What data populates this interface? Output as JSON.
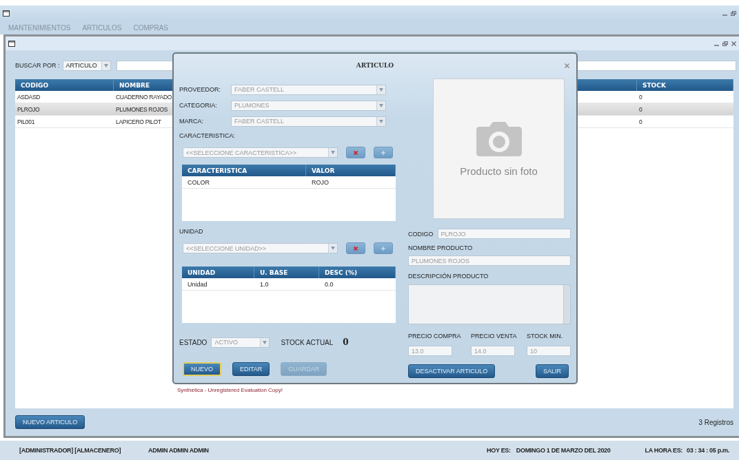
{
  "window": {
    "menu": [
      {
        "label": "MANTENIMIENTOS"
      },
      {
        "label": "ARTICULOS"
      },
      {
        "label": "COMPRAS"
      }
    ]
  },
  "articles": {
    "search": {
      "label": "BUSCAR POR :",
      "by": "ARTICULO"
    },
    "table": {
      "columns": [
        "CODIGO",
        "NOMBRE",
        "STOCK"
      ],
      "rows": [
        {
          "cells": [
            "ASDASD",
            "CUADERNO RAYADO",
            "0"
          ],
          "selected": false
        },
        {
          "cells": [
            "PLROJO",
            "PLUMONES ROJOS",
            "0"
          ],
          "selected": true
        },
        {
          "cells": [
            "PIL001",
            "LAPICERO PILOT",
            "0"
          ],
          "selected": false
        }
      ]
    },
    "new_button": "NUEVO ARTICULO",
    "record_count": "3 Registros"
  },
  "dialog": {
    "title": "ARTICULO",
    "combos": [
      {
        "label": "PROVEEDOR:",
        "value": "FABER CASTELL",
        "disabled": true
      },
      {
        "label": "CATEGORIA:",
        "value": "PLUMONES",
        "disabled": true
      },
      {
        "label": "MARCA:",
        "value": "FABER CASTELL",
        "disabled": true
      }
    ],
    "features": {
      "label": "CARACTERISTICA:",
      "placeholder": "<<SELECCIONE CARACTERISTICA>>",
      "table": {
        "columns": [
          "CARACTERISTICA",
          "VALOR"
        ],
        "rows": [
          [
            "COLOR",
            "ROJO"
          ]
        ]
      }
    },
    "units": {
      "label": "UNIDAD",
      "placeholder": "<<SELECCIONE UNIDAD>>",
      "table": {
        "columns": [
          "UNIDAD",
          "U. BASE",
          "DESC (%)"
        ],
        "rows": [
          [
            "Unidad",
            "1.0",
            "0.0"
          ]
        ]
      }
    },
    "estado": {
      "label": "ESTADO",
      "value": "ACTIVO",
      "disabled": true
    },
    "stock": {
      "label": "STOCK ACTUAL",
      "value": "0"
    },
    "left_buttons": [
      {
        "label": "NUEVO",
        "focused": true,
        "disabled": false
      },
      {
        "label": "EDITAR",
        "focused": false,
        "disabled": false
      },
      {
        "label": "GUARDAR",
        "focused": false,
        "disabled": true
      }
    ],
    "photo": {
      "caption": "Producto sin foto"
    },
    "codigo": {
      "label": "CODIGO",
      "value": "PLROJO",
      "disabled": true
    },
    "nombre": {
      "label": "NOMBRE PRODUCTO",
      "value": "PLUMONES ROJOS",
      "disabled": true
    },
    "descripcion": {
      "label": "DESCRIPCIÓN PRODUCTO"
    },
    "prices": [
      {
        "label": "PRECIO COMPRA",
        "value": "13.0",
        "disabled": true
      },
      {
        "label": "PRECIO VENTA",
        "value": "14.0",
        "disabled": true
      },
      {
        "label": "STOCK MIN.",
        "value": "10",
        "disabled": true
      }
    ],
    "right_buttons": [
      {
        "label": "DESACTIVAR ARTICULO"
      },
      {
        "label": "SALIR"
      }
    ],
    "license_note": "Synthetica - Unregistered Evaluation Copy!"
  },
  "status_bar": {
    "roles": "[ADMINISTRADOR] [ALMACENERO]",
    "user": "ADMIN ADMIN ADMIN",
    "date_label": "HOY ES:",
    "date": "DOMINGO 1 DE MARZO DEL 2020",
    "time_label": "LA HORA ES:",
    "time": "03 : 34 : 05 p.m."
  }
}
